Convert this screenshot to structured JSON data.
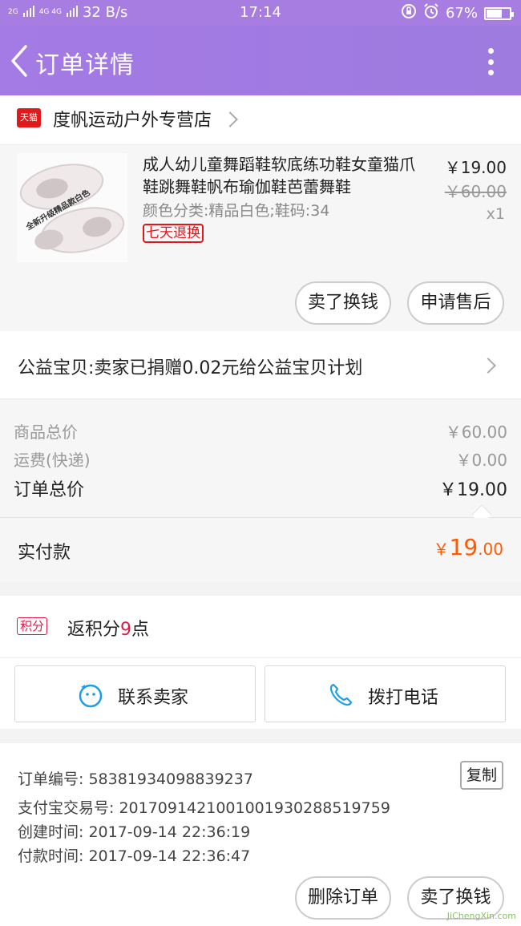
{
  "status_bar": {
    "signal_a": "2G",
    "signal_b": "4G 4G",
    "speed": "32 B/s",
    "time": "17:14",
    "battery": "67%",
    "battery_level": 0.67
  },
  "header": {
    "title": "订单详情"
  },
  "store": {
    "badge": "天猫",
    "name": "度帆运动户外专营店"
  },
  "product": {
    "title": "成人幼儿童舞蹈鞋软底练功鞋女童猫爪鞋跳舞鞋帆布瑜伽鞋芭蕾舞鞋",
    "sku": "颜色分类:精品白色;鞋码:34",
    "tag": "七天退换",
    "thumb_caption": "全新升级精品款白色",
    "price": "￥19.00",
    "original_price": "￥60.00",
    "quantity": "x1",
    "actions": {
      "resell": "卖了换钱",
      "after_sale": "申请售后"
    }
  },
  "charity": {
    "text": "公益宝贝:卖家已捐赠0.02元给公益宝贝计划"
  },
  "price_summary": {
    "goods_label": "商品总价",
    "goods_value": "￥60.00",
    "shipping_label": "运费(快递)",
    "shipping_value": "￥0.00",
    "total_label": "订单总价",
    "total_value": "￥19.00"
  },
  "paid": {
    "label": "实付款",
    "currency": "￥",
    "integer": "19",
    "decimal": ".00"
  },
  "points": {
    "badge": "积分",
    "prefix": "返积分",
    "number": "9",
    "suffix": "点"
  },
  "contact": {
    "seller": "联系卖家",
    "call": "拨打电话"
  },
  "order_info": {
    "number": "订单编号: 58381934098839237",
    "alipay": "支付宝交易号: 2017091421001001930288519759",
    "created": "创建时间: 2017-09-14 22:36:19",
    "paid_time": "付款时间: 2017-09-14 22:36:47",
    "copy": "复制"
  },
  "bottom_actions": {
    "delete": "删除订单",
    "resell": "卖了换钱"
  },
  "watermark": "JiChengXin.com",
  "colors": {
    "accent": "#a47ae4",
    "price": "#ff5a00",
    "tmall": "#e01a1a"
  }
}
